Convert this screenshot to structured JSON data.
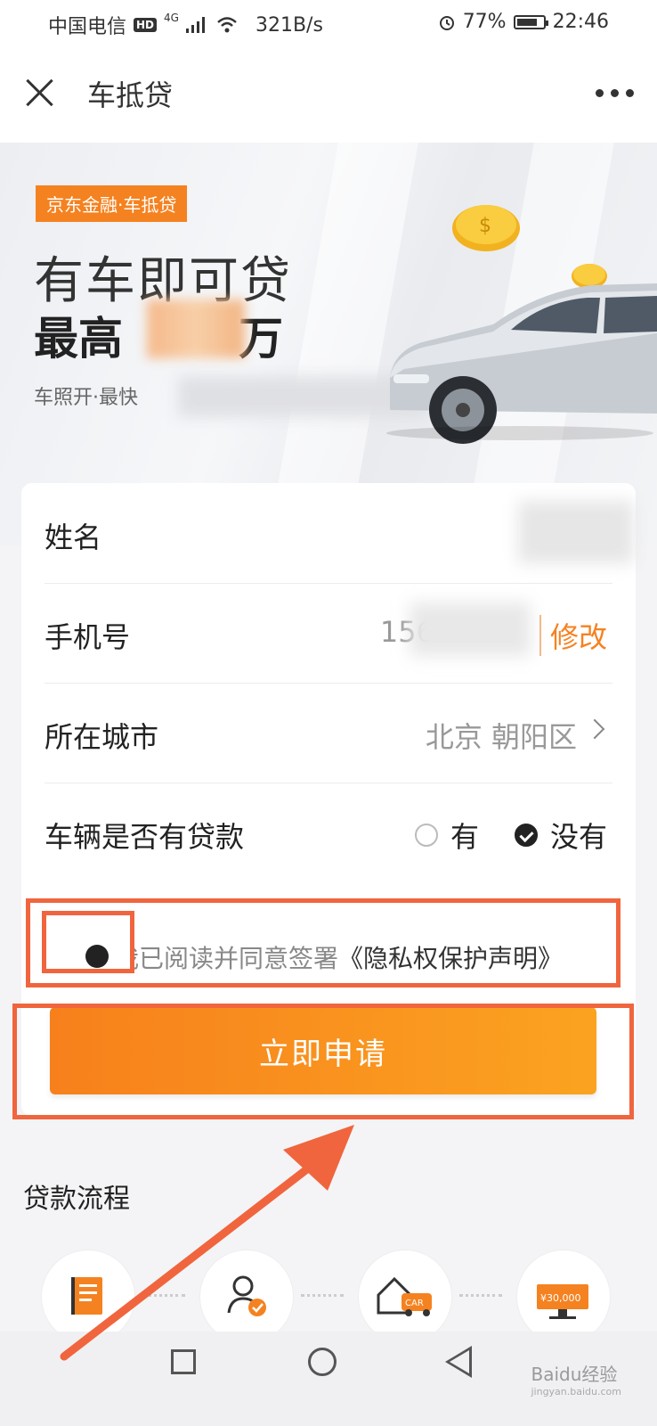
{
  "status_bar": {
    "carrier": "中国电信",
    "hd": "HD",
    "network": "4G",
    "speed": "321B/s",
    "battery": "77%",
    "battery_level": 0.77,
    "time": "22:46"
  },
  "header": {
    "title": "车抵贷"
  },
  "banner": {
    "badge": "京东金融·车抵贷",
    "headline": "有车即可贷",
    "amount_line": "最高",
    "amount_unit": "万",
    "subline": "车照开·最快"
  },
  "form": {
    "name_label": "姓名",
    "phone_label": "手机号",
    "phone_value": "156",
    "phone_edit": "修改",
    "city_label": "所在城市",
    "city_value": "北京 朝阳区",
    "loan_label": "车辆是否有贷款",
    "loan_option_yes": "有",
    "loan_option_no": "没有",
    "loan_selected": "没有"
  },
  "agreement": {
    "prefix": "我已阅读并同意签署",
    "link": "《隐私权保护声明》"
  },
  "submit": {
    "label": "立即申请"
  },
  "process": {
    "title": "贷款流程",
    "steps": [
      {
        "icon": "document-icon"
      },
      {
        "icon": "person-verified-icon"
      },
      {
        "icon": "house-car-icon",
        "tag": "CAR"
      },
      {
        "icon": "cash-screen-icon",
        "amount": "¥30,000"
      }
    ]
  },
  "watermark": {
    "text": "Baidu经验",
    "sub": "jingyan.baidu.com"
  },
  "colors": {
    "accent": "#f58220",
    "annotation": "#f0653e"
  }
}
